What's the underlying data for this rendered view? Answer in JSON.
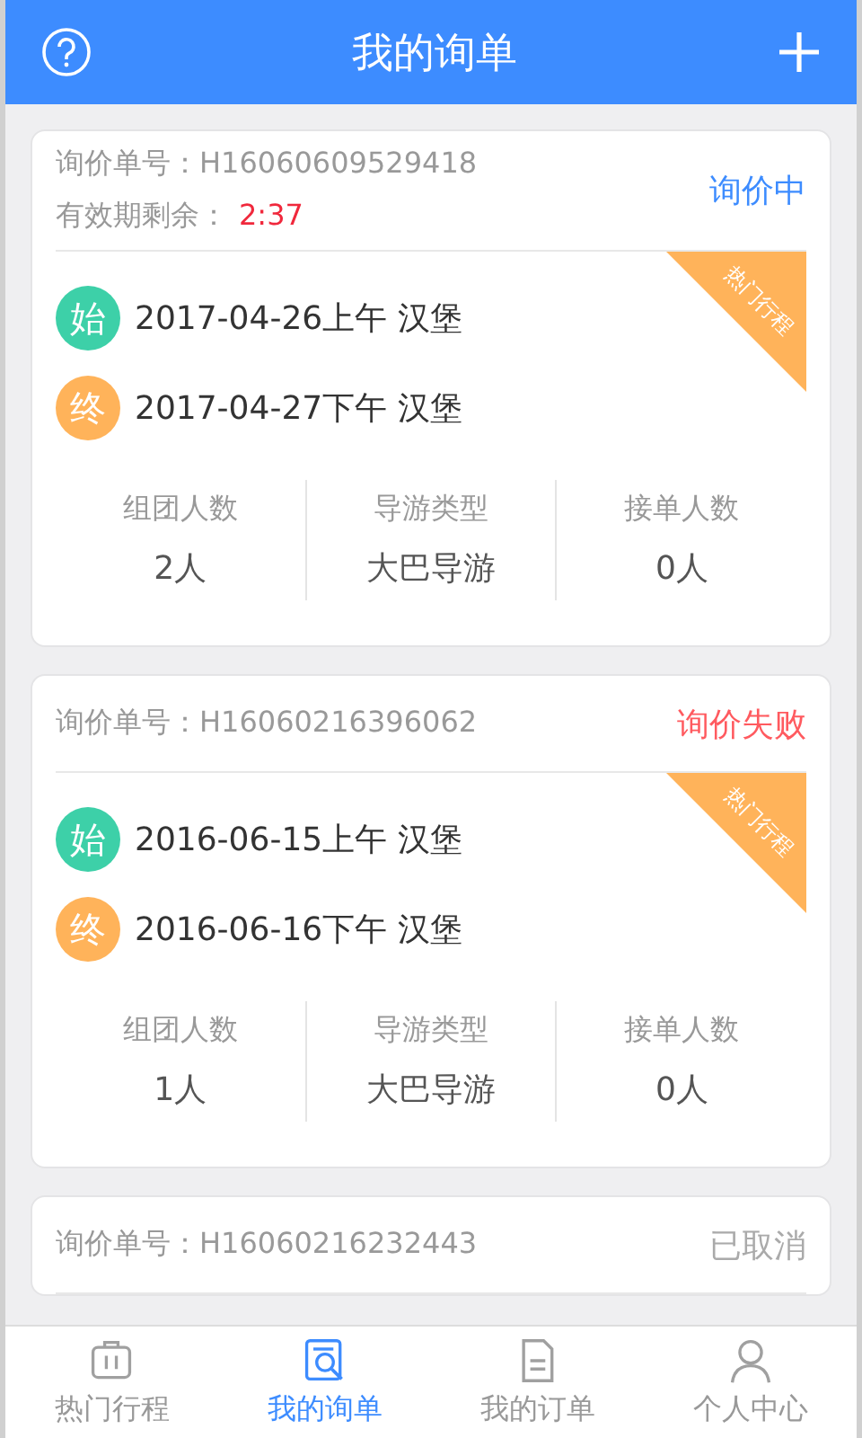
{
  "header": {
    "title": "我的询单"
  },
  "inquiries": [
    {
      "order": "询价单号：H16060609529418",
      "expiry": {
        "label": "有效期剩余：",
        "value": "2:37"
      },
      "status": {
        "text": "询价中",
        "kind": "pending"
      },
      "ribbon": "热门行程",
      "start": {
        "badge": "始",
        "text": "2017-04-26上午 汉堡"
      },
      "end": {
        "badge": "终",
        "text": "2017-04-27下午 汉堡"
      },
      "stats": [
        {
          "label": "组团人数",
          "value": "2人"
        },
        {
          "label": "导游类型",
          "value": "大巴导游"
        },
        {
          "label": "接单人数",
          "value": "0人"
        }
      ]
    },
    {
      "order": "询价单号：H16060216396062",
      "status": {
        "text": "询价失败",
        "kind": "failed"
      },
      "ribbon": "热门行程",
      "start": {
        "badge": "始",
        "text": "2016-06-15上午 汉堡"
      },
      "end": {
        "badge": "终",
        "text": "2016-06-16下午 汉堡"
      },
      "stats": [
        {
          "label": "组团人数",
          "value": "1人"
        },
        {
          "label": "导游类型",
          "value": "大巴导游"
        },
        {
          "label": "接单人数",
          "value": "0人"
        }
      ]
    },
    {
      "order": "询价单号：H16060216232443",
      "status": {
        "text": "已取消",
        "kind": "cancelled"
      }
    }
  ],
  "tabs": [
    {
      "label": "热门行程",
      "selected": false
    },
    {
      "label": "我的询单",
      "selected": true
    },
    {
      "label": "我的订单",
      "selected": false
    },
    {
      "label": "个人中心",
      "selected": false
    }
  ]
}
